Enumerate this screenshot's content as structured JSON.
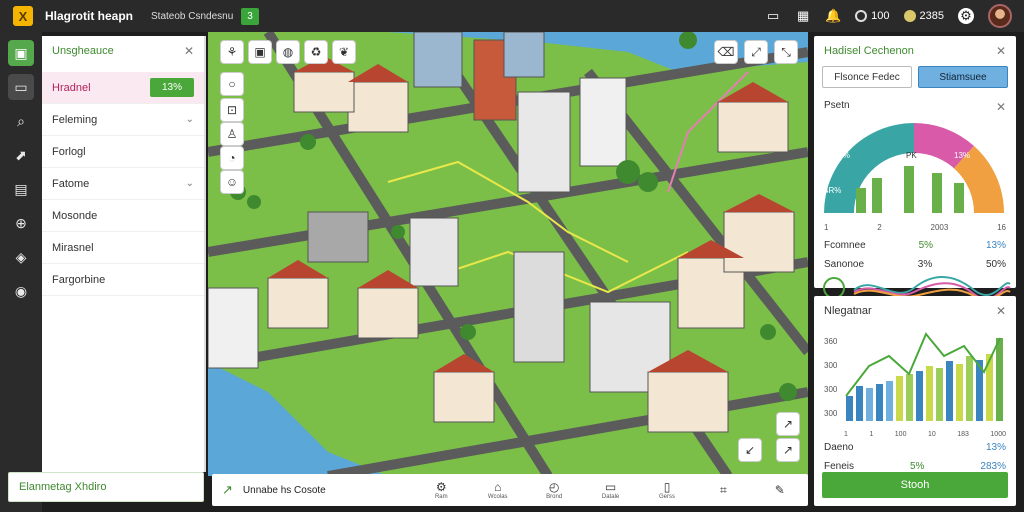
{
  "topbar": {
    "logo_glyph": "X",
    "title": "Hlagrotit heapn",
    "subtitle": "Stateob Csndesnu",
    "badge": "3",
    "coins": "100",
    "gems": "2385"
  },
  "left_panel": {
    "title": "Unsgheauce",
    "rows": [
      {
        "label": "Hradnel",
        "value": "13%"
      },
      {
        "label": "Feleming"
      },
      {
        "label": "Forlogl"
      },
      {
        "label": "Fatome"
      },
      {
        "label": "Mosonde"
      },
      {
        "label": "Mirasnel"
      },
      {
        "label": "Fargorbine"
      }
    ],
    "footer": "Elanmetag Xhdiro"
  },
  "bottom_bar": {
    "label": "Unnabe hs Cosote",
    "tools": [
      "Ram",
      "Wcolas",
      "Brond",
      "Datale",
      "Gerss",
      "",
      ""
    ]
  },
  "right_panel_1": {
    "title": "Hadisel Cechenon",
    "tabs": [
      "Flsonce Fedec",
      "Stiamsuee"
    ],
    "section_label": "Psetn",
    "gauge_labels": [
      "4R%",
      "53%",
      "13%",
      "PK"
    ],
    "bar_labels": [
      "1",
      "2",
      "2003",
      "16"
    ],
    "row1": {
      "label": "Fcomnee",
      "v1": "5%",
      "v2": "13%"
    },
    "row2": {
      "label": "Sanonoe",
      "v1": "3%",
      "v2": "50%"
    }
  },
  "right_panel_2": {
    "title": "Nlegatnar",
    "ytick_labels": [
      "360",
      "300",
      "300",
      "300"
    ],
    "xtick_labels": [
      "1",
      "1",
      "100",
      "10",
      "183",
      "1000"
    ],
    "row1": {
      "label": "Daeno",
      "v1": "",
      "v2": "13%"
    },
    "row2": {
      "label": "Feneis",
      "v1": "5%",
      "v2": "283%"
    },
    "button": "Stooh"
  },
  "colors": {
    "accent": "#4aa83a",
    "blue": "#6fb0e0",
    "water": "#5aa7d8",
    "road": "#5b5b5b"
  }
}
